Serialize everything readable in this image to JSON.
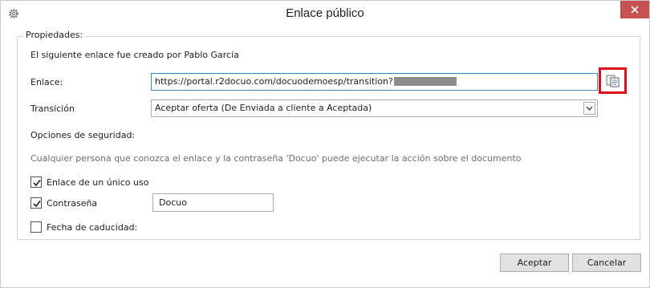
{
  "window": {
    "title": "Enlace público"
  },
  "group": {
    "legend": "Propiedades:"
  },
  "created_by_text": "El siguiente enlace fue creado por Pablo García",
  "link": {
    "label": "Enlace:",
    "value": "https://portal.r2docuo.com/docuodemoesp/transition?",
    "copy_icon": "copy-to-clipboard-icon",
    "highlight_color": "#e0101a"
  },
  "transition": {
    "label": "Transición",
    "selected": "Aceptar oferta (De Enviada a cliente a Aceptada)"
  },
  "security": {
    "heading": "Opciones de seguridad:",
    "note": "Cualquier persona que conozca el enlace y la contraseña 'Docuo' puede ejecutar la acción sobre el documento"
  },
  "options": {
    "single_use": {
      "label": "Enlace de un único uso",
      "checked": true
    },
    "password": {
      "label": "Contraseña",
      "checked": true,
      "value": "Docuo"
    },
    "expiry": {
      "label": "Fecha de caducidad:",
      "checked": false
    }
  },
  "buttons": {
    "accept": "Aceptar",
    "cancel": "Cancelar"
  }
}
